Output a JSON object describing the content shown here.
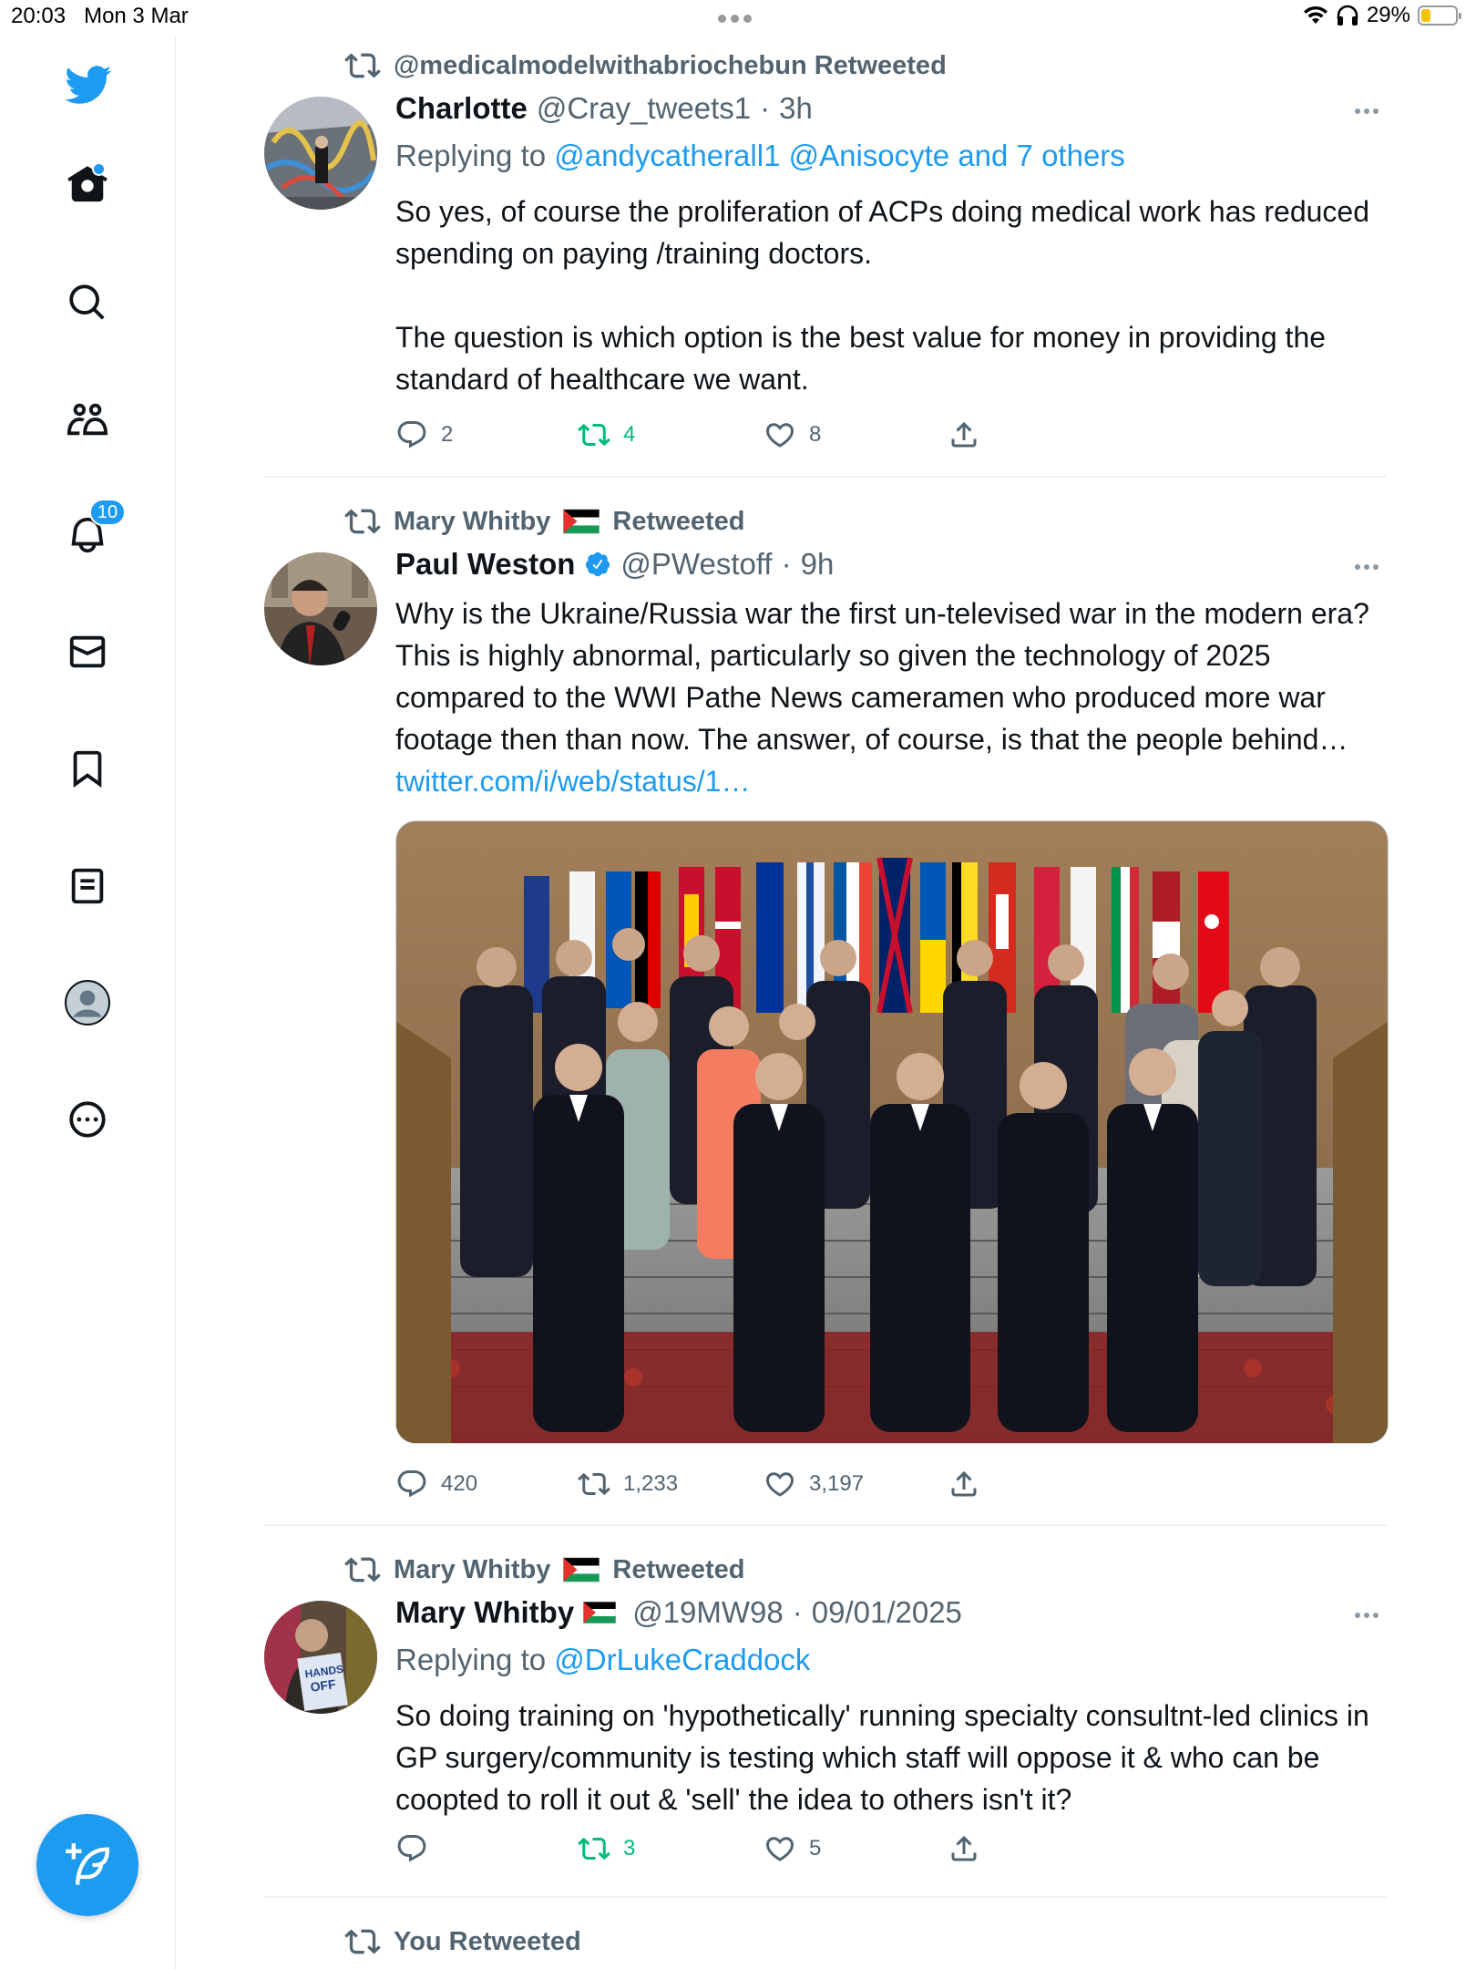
{
  "status_bar": {
    "time": "20:03",
    "date": "Mon 3 Mar",
    "battery": "29%",
    "battery_level": 0.29
  },
  "sidebar": {
    "items": [
      {
        "icon": "twitter-logo-icon"
      },
      {
        "icon": "home-icon",
        "has_dot": true
      },
      {
        "icon": "search-icon"
      },
      {
        "icon": "communities-icon"
      },
      {
        "icon": "notifications-icon",
        "badge": "10"
      },
      {
        "icon": "messages-icon"
      },
      {
        "icon": "bookmarks-icon"
      },
      {
        "icon": "lists-icon"
      },
      {
        "icon": "profile-icon"
      },
      {
        "icon": "more-icon"
      }
    ],
    "compose_icon": "compose-tweet-icon",
    "accent_color": "#1d9bf0"
  },
  "tweets": [
    {
      "retweeted_by": "@medicalmodelwithabriochebun Retweeted",
      "name": "Charlotte",
      "handle": "@Cray_tweets1",
      "sep": "·",
      "time": "3h",
      "replying_prefix": "Replying to",
      "replying_to": "@andycatherall1 @Anisocyte and 7 others",
      "paragraphs": [
        "So yes, of course the proliferation of ACPs doing medical work has reduced spending on paying /training doctors.",
        "The question is which option is the best value for money in providing the standard of healthcare we want."
      ],
      "replies": "2",
      "retweets": "4",
      "likes": "8"
    },
    {
      "retweeted_by": "Mary Whitby",
      "retweeted_suffix": "Retweeted",
      "name": "Paul Weston",
      "verified": true,
      "handle": "@PWestoff",
      "sep": "·",
      "time": "9h",
      "text": "Why is the Ukraine/Russia war the first un-televised war in the modern era? This is highly abnormal, particularly so given the technology of 2025 compared to the WWI Pathe News cameramen who produced more war footage then than now. The answer, of course, is that the people behind…",
      "link": "twitter.com/i/web/status/1…",
      "replies": "420",
      "retweets": "1,233",
      "likes": "3,197"
    },
    {
      "retweeted_by": "Mary Whitby",
      "retweeted_suffix": "Retweeted",
      "name": "Mary Whitby",
      "handle": "@19MW98",
      "sep": "·",
      "time": "09/01/2025",
      "replying_prefix": "Replying to",
      "replying_to": "@DrLukeCraddock",
      "text": "So doing training on 'hypothetically' running specialty consultnt-led clinics in GP surgery/community is testing which staff will oppose it & who can be coopted to roll it out & 'sell' the idea to others isn't it?",
      "replies": "",
      "retweets": "3",
      "likes": "5"
    },
    {
      "retweeted_by": "You Retweeted"
    }
  ],
  "colors": {
    "text": "#0f1419",
    "secondary": "#536471",
    "link": "#1d9bf0",
    "retweet_green": "#00ba7c"
  }
}
